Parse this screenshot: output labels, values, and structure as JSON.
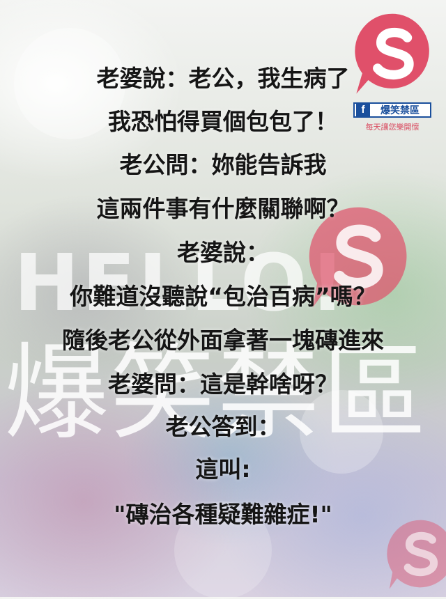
{
  "watermark": {
    "hello": "HELLO!",
    "brand": "爆笑禁區"
  },
  "brand_badge": {
    "fb_letter": "f",
    "page_name": "爆笑禁區",
    "slogan": "每天讓您樂開懷"
  },
  "colors": {
    "logo_red": "#e0506a",
    "fb_blue": "#1a4f9c",
    "text": "#151515"
  },
  "joke_lines": [
    "老婆說：老公，我生病了",
    "我恐怕得買個包包了！",
    "老公問：妳能告訴我",
    "這兩件事有什麼關聯啊？",
    "老婆說：",
    "你難道沒聽說“包治百病”嗎？",
    "隨後老公從外面拿著一塊磚進來",
    "老婆問：這是幹啥呀？",
    "老公答到：",
    "這叫:",
    "\"磚治各種疑難雜症!\""
  ]
}
